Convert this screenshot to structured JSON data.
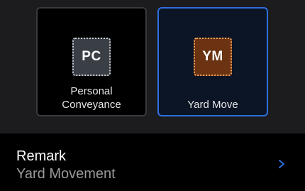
{
  "options": {
    "personal_conveyance": {
      "badge": "PC",
      "label_line1": "Personal",
      "label_line2": "Conveyance",
      "selected": false
    },
    "yard_move": {
      "badge": "YM",
      "label": "Yard Move",
      "selected": true
    }
  },
  "remark": {
    "title": "Remark",
    "value": "Yard Movement",
    "icon": "chevron-right-icon"
  },
  "colors": {
    "selected_border": "#2f6fe0",
    "pc_badge": "#3a3f46",
    "ym_badge": "#6b3312",
    "chevron": "#2f6fe0"
  }
}
